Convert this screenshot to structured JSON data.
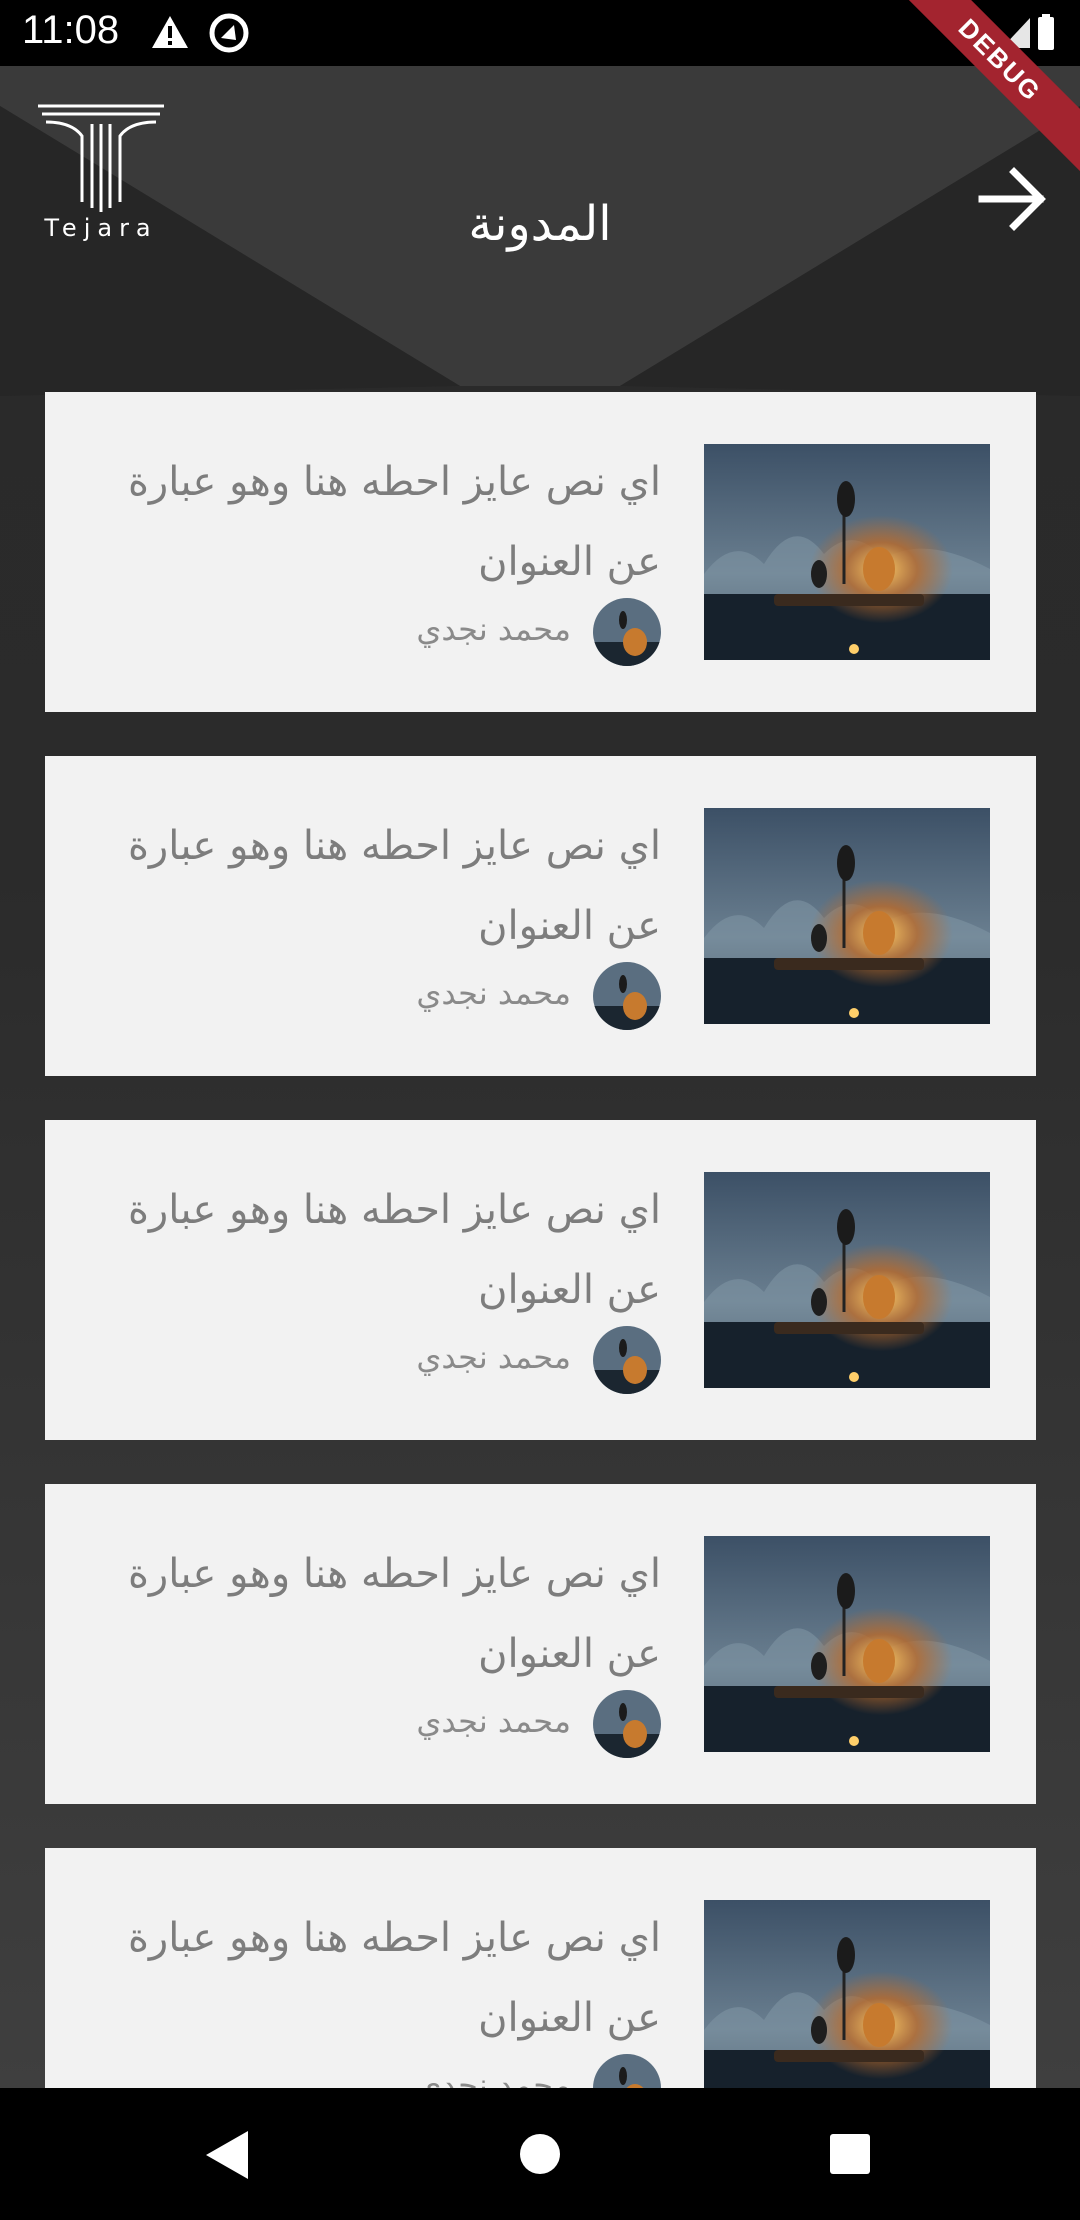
{
  "status_bar": {
    "time": "11:08"
  },
  "debug_banner": "DEBUG",
  "header": {
    "logo_text": "Tejara",
    "title": "المدونة"
  },
  "posts": [
    {
      "title": "اي نص عايز احطه هنا وهو عبارة عن العنوان",
      "author": "محمد نجدي"
    },
    {
      "title": "اي نص عايز احطه هنا وهو عبارة عن العنوان",
      "author": "محمد نجدي"
    },
    {
      "title": "اي نص عايز احطه هنا وهو عبارة عن العنوان",
      "author": "محمد نجدي"
    },
    {
      "title": "اي نص عايز احطه هنا وهو عبارة عن العنوان",
      "author": "محمد نجدي"
    },
    {
      "title": "اي نص عايز احطه هنا وهو عبارة عن العنوان",
      "author": "محمد نجدي"
    }
  ],
  "icons": {
    "back": "arrow-right-icon",
    "warning": "warning-icon",
    "sync": "sync-icon",
    "wifi": "wifi-icon",
    "signal": "signal-icon",
    "battery": "battery-icon",
    "nav_back": "nav-back-icon",
    "nav_home": "nav-home-icon",
    "nav_recent": "nav-recent-icon"
  },
  "colors": {
    "background": "#2b2b2b",
    "card": "#f2f2f2",
    "title_text": "#7d7d7d",
    "debug": "#a3242f"
  }
}
